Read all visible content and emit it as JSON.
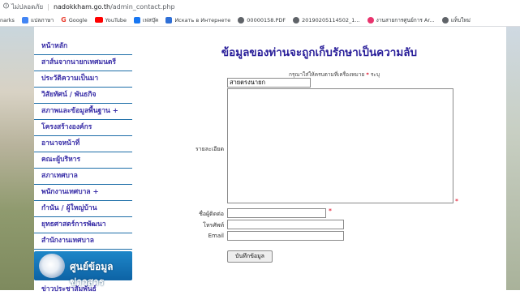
{
  "browser": {
    "security_label": "ไม่ปลอดภัย",
    "host": "nadokkham.go.th",
    "path": "/admin_contact.php"
  },
  "bookmarks": [
    {
      "label": "narks",
      "icon": "bookmarks-cut-icon",
      "color": "#ffffff"
    },
    {
      "label": "แปลภาษา",
      "icon": "translate-icon",
      "color": "#4285f4"
    },
    {
      "label": "Google",
      "icon": "google-icon",
      "color": "#ea4335"
    },
    {
      "label": "YouTube",
      "icon": "youtube-icon",
      "color": "#ff0000"
    },
    {
      "label": "เฟสบุ๊ค",
      "icon": "facebook-icon",
      "color": "#1877f2"
    },
    {
      "label": "Искать в Интернете",
      "icon": "search-web-icon",
      "color": "#2f6fd6"
    },
    {
      "label": "00000158.PDF",
      "icon": "globe-icon",
      "color": "#5f6368"
    },
    {
      "label": "20190205114502_1...",
      "icon": "globe-icon",
      "color": "#5f6368"
    },
    {
      "label": "งานสายการศูนย์การ Ar...",
      "icon": "flower-icon",
      "color": "#e8336d"
    },
    {
      "label": "แท็บใหม่",
      "icon": "globe-icon",
      "color": "#5f6368"
    }
  ],
  "sidebar": {
    "items": [
      {
        "label": "หน้าหลัก"
      },
      {
        "label": "สาส์นจากนายกเทศมนตรี"
      },
      {
        "label": "ประวัติความเป็นมา"
      },
      {
        "label": "วิสัยทัศน์ / พันธกิจ"
      },
      {
        "label": "สภาพและข้อมูลพื้นฐาน +"
      },
      {
        "label": "โครงสร้างองค์กร"
      },
      {
        "label": "อานาจหน้าที่"
      },
      {
        "label": "คณะผู้บริหาร"
      },
      {
        "label": "สภาเทศบาล"
      },
      {
        "label": "พนักงานเทศบาล +"
      },
      {
        "label": "กํานัน / ผู้ใหญ่บ้าน"
      },
      {
        "label": "ยุทธศาสตร์การพัฒนา"
      },
      {
        "label": "สำนักงานเทศบาล"
      }
    ],
    "banner": "ศูนย์ข้อมูลข่าวสาร",
    "news": "ข่าวประชาสัมพันธ์"
  },
  "form": {
    "heading": "ข้อมูลของท่านจะถูกเก็บรักษาเป็นความลับ",
    "note_prefix": "กรุณาใส่ให้ครบตามที่เครื่องหมาย",
    "note_star": "*",
    "note_suffix": "ระบุ",
    "subject_value": "สายตรงนายก",
    "detail_label": "รายละเอียด",
    "name_label": "ชื่อผู้ติดต่อ",
    "phone_label": "โทรศัพท์",
    "email_label": "Email",
    "required_mark": "*",
    "submit_label": "บันทึกข้อมูล"
  }
}
